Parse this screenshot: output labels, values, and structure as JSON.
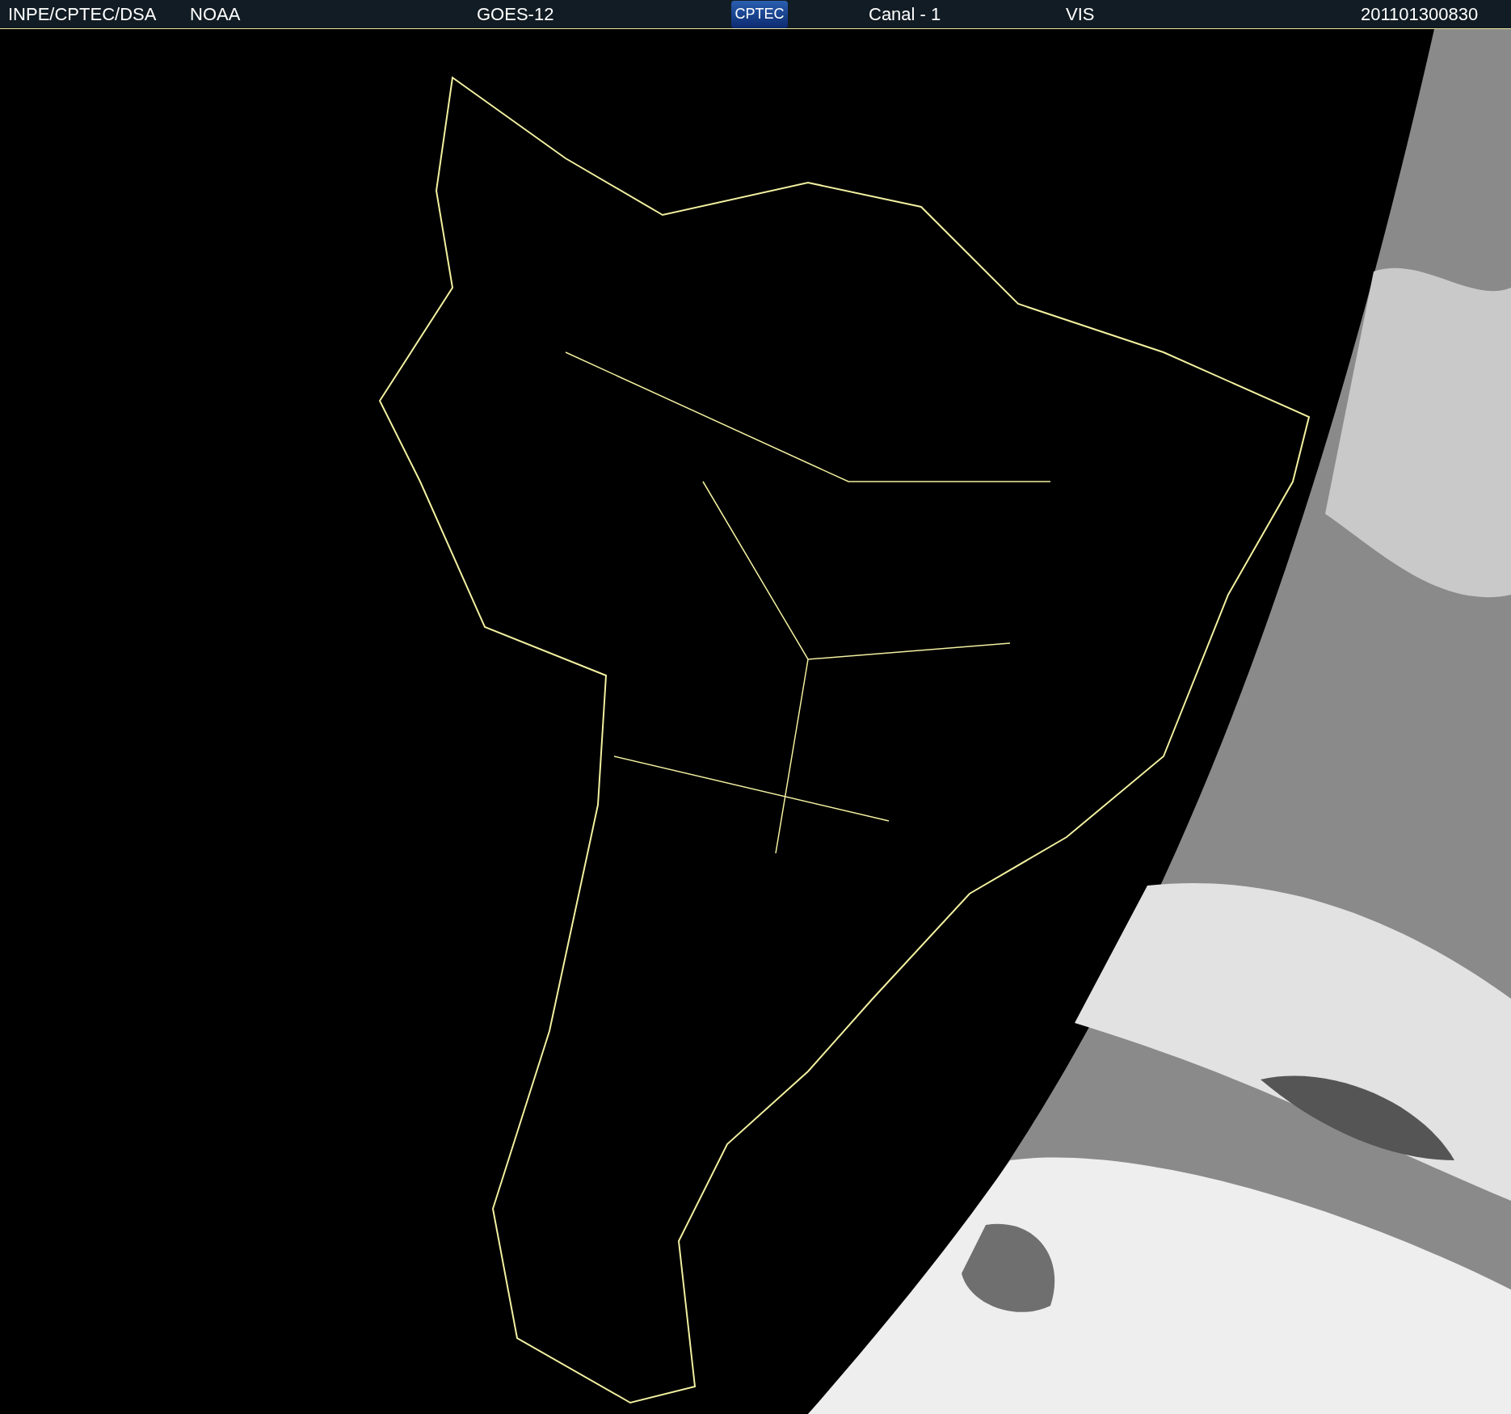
{
  "header": {
    "source": "INPE/CPTEC/DSA",
    "agency": "NOAA",
    "satellite": "GOES-12",
    "logo": "CPTEC",
    "channel": "Canal - 1",
    "band": "VIS",
    "timestamp": "201101300830"
  }
}
